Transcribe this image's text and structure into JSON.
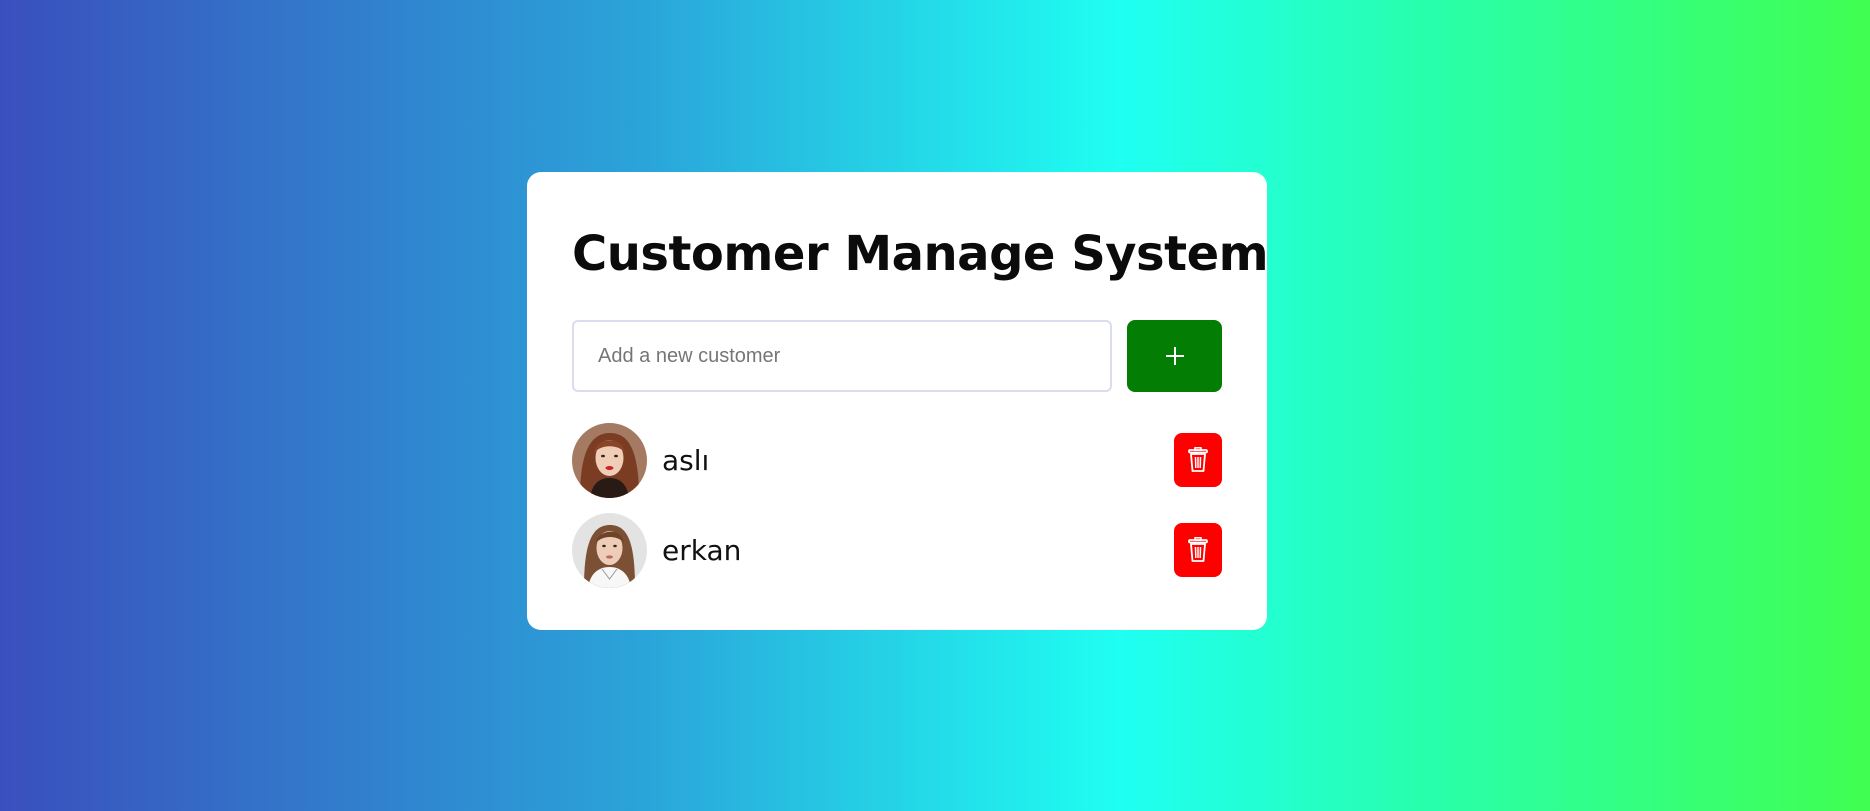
{
  "app": {
    "title": "Customer Manage System"
  },
  "add_form": {
    "input_value": "",
    "placeholder": "Add a new customer",
    "add_icon": "plus-icon"
  },
  "customers": [
    {
      "name": "aslı",
      "avatar": "avatar-photo",
      "delete_icon": "trash-icon"
    },
    {
      "name": "erkan",
      "avatar": "avatar-photo",
      "delete_icon": "trash-icon"
    }
  ],
  "colors": {
    "add_button": "#037d03",
    "delete_button": "#ff0000",
    "card": "#ffffff"
  }
}
